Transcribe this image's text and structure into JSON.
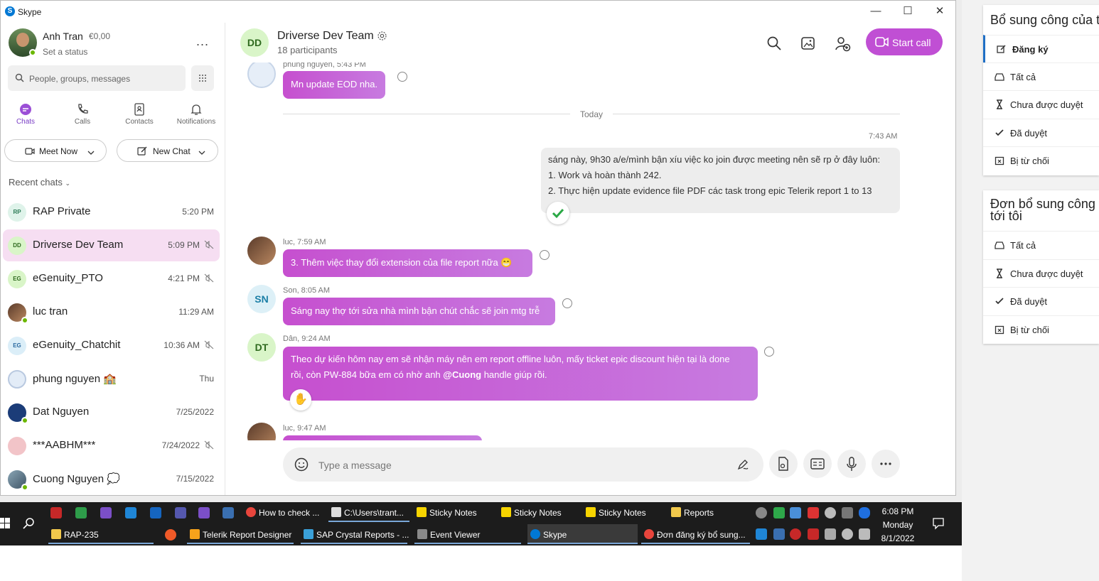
{
  "window": {
    "title": "Skype",
    "minimize": "—",
    "maximize": "☐",
    "close": "✕"
  },
  "profile": {
    "name": "Anh Tran",
    "credit": "€0,00",
    "status": "Set a status",
    "more": "..."
  },
  "search": {
    "placeholder": "People, groups, messages"
  },
  "nav": {
    "chats": "Chats",
    "calls": "Calls",
    "contacts": "Contacts",
    "notifications": "Notifications"
  },
  "actions": {
    "meet_now": "Meet Now",
    "new_chat": "New Chat"
  },
  "recent_label": "Recent chats",
  "chats": [
    {
      "initials": "RP",
      "name": "RAP Private",
      "time": "5:20 PM",
      "muted": false,
      "selected": false
    },
    {
      "initials": "DD",
      "name": "Driverse Dev Team",
      "time": "5:09 PM",
      "muted": true,
      "selected": true
    },
    {
      "initials": "EG",
      "name": "eGenuity_PTO",
      "time": "4:21 PM",
      "muted": true,
      "selected": false
    },
    {
      "initials": "",
      "name": "luc tran",
      "time": "11:29 AM",
      "muted": false,
      "selected": false
    },
    {
      "initials": "EG",
      "name": "eGenuity_Chatchit",
      "time": "10:36 AM",
      "muted": true,
      "selected": false
    },
    {
      "initials": "",
      "name": "phung nguyen 🏫",
      "time": "Thu",
      "muted": false,
      "selected": false
    },
    {
      "initials": "",
      "name": "Dat Nguyen",
      "time": "7/25/2022",
      "muted": false,
      "selected": false
    },
    {
      "initials": "",
      "name": "***AABHM***",
      "time": "7/24/2022",
      "muted": true,
      "selected": false
    },
    {
      "initials": "",
      "name": "Cuong Nguyen 💭",
      "time": "7/15/2022",
      "muted": false,
      "selected": false
    }
  ],
  "conversation": {
    "initials": "DD",
    "name": "Driverse Dev Team",
    "participants": "18 participants",
    "start_call": "Start call",
    "today": "Today",
    "messages": [
      {
        "sender": "phung nguyen, 5:43 PM",
        "text": "Mn update EOD nha."
      },
      {
        "time": "7:43 AM",
        "lines": [
          "sáng này, 9h30 a/e/mình bận xíu việc ko join được meeting nên sẽ rp ở đây luôn:",
          "1. Work và hoàn thành 242.",
          "2. Thực hiện update evidence file PDF các task trong epic Telerik report 1 to 13"
        ]
      },
      {
        "sender": "luc, 7:59 AM",
        "text": "3. Thêm việc thay đổi extension của file report nữa 😁"
      },
      {
        "initials": "SN",
        "sender": "Son, 8:05 AM",
        "text": "Sáng nay thợ tới sửa nhà mình bận chút chắc sẽ join mtg trễ"
      },
      {
        "initials": "DT",
        "sender": "Dân, 9:24 AM",
        "line1": "Theo dự kiến hôm nay em sẽ nhận máy nên em report offline luôn, mấy ticket epic discount hiện tại là done",
        "line2a": "rồi, còn PW-884 bữa em có nhờ anh ",
        "mention": "@Cuong",
        "line2b": " handle giúp rồi."
      },
      {
        "sender": "luc, 9:47 AM",
        "text": ""
      }
    ],
    "composer_placeholder": "Type a message"
  },
  "right_panel": {
    "card1_title": "Bổ sung công của t",
    "card1_items": [
      "Đăng ký",
      "Tất cả",
      "Chưa được duyệt",
      "Đã duyệt",
      "Bị từ chối"
    ],
    "card2_title_1": "Đơn bổ sung công",
    "card2_title_2": "tới tôi",
    "card2_items": [
      "Tất cả",
      "Chưa được duyệt",
      "Đã duyệt",
      "Bị từ chối"
    ]
  },
  "taskbar": {
    "row1": [
      "How to check ...",
      "C:\\Users\\trant...",
      "Sticky Notes",
      "Sticky Notes",
      "Sticky Notes",
      "Reports"
    ],
    "row2": [
      "RAP-235",
      "Telerik Report Designer",
      "SAP Crystal Reports - ...",
      "Event Viewer",
      "Skype",
      "Đơn đăng ký bổ sung..."
    ],
    "clock_time": "6:08 PM",
    "clock_day": "Monday",
    "clock_date": "8/1/2022"
  },
  "colors": {
    "accent": "#c04fd4",
    "selected_chat": "#f6def2",
    "presence": "#6bb700",
    "taskbar": "#1c1c1c"
  }
}
